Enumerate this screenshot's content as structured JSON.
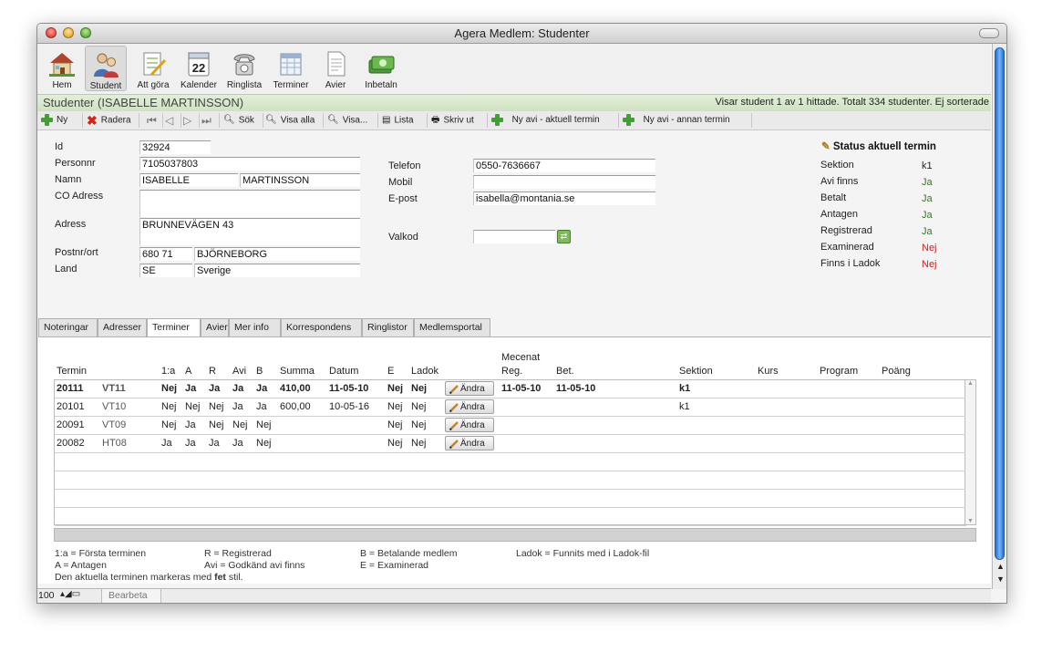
{
  "window": {
    "title": "Agera Medlem: Studenter"
  },
  "toolbar": [
    {
      "label": "Hem",
      "icon": "house-icon"
    },
    {
      "label": "Student",
      "icon": "student-icon"
    },
    {
      "label": "Att göra",
      "icon": "todo-icon"
    },
    {
      "label": "Kalender",
      "icon": "calendar-icon",
      "day": "22"
    },
    {
      "label": "Ringlista",
      "icon": "telephone-icon"
    },
    {
      "label": "Terminer",
      "icon": "term-calendar-icon"
    },
    {
      "label": "Avier",
      "icon": "document-icon"
    },
    {
      "label": "Inbetaln",
      "icon": "money-icon"
    }
  ],
  "header": {
    "title": "Studenter (ISABELLE MARTINSSON)",
    "status": "Visar student 1 av 1 hittade. Totalt 334 studenter. Ej sorterade"
  },
  "actions": {
    "new": "Ny",
    "delete": "Radera",
    "search": "Sök",
    "show_all": "Visa alla",
    "show": "Visa...",
    "list": "Lista",
    "print": "Skriv ut",
    "new_avi_current": "Ny avi - aktuell termin",
    "new_avi_other": "Ny avi - annan termin"
  },
  "form": {
    "labels": {
      "id": "Id",
      "personnr": "Personnr",
      "namn": "Namn",
      "co": "CO Adress",
      "adress": "Adress",
      "postnr": "Postnr/ort",
      "land": "Land",
      "telefon": "Telefon",
      "mobil": "Mobil",
      "epost": "E-post",
      "valkod": "Valkod"
    },
    "values": {
      "id": "32924",
      "personnr": "7105037803",
      "first_name": "ISABELLE",
      "last_name": "MARTINSSON",
      "co": "",
      "adress": "BRUNNEVÄGEN 43",
      "postnr": "680 71",
      "ort": "BJÖRNEBORG",
      "land_code": "SE",
      "land": "Sverige",
      "telefon": "0550-7636667",
      "mobil": "",
      "epost": "isabella@montania.se",
      "valkod": ""
    }
  },
  "status": {
    "title": "Status aktuell termin",
    "items": [
      {
        "label": "Sektion",
        "value": "k1",
        "color": "#222222"
      },
      {
        "label": "Avi finns",
        "value": "Ja",
        "color": "#2f7d1f"
      },
      {
        "label": "Betalt",
        "value": "Ja",
        "color": "#2f7d1f"
      },
      {
        "label": "Antagen",
        "value": "Ja",
        "color": "#2f7d1f"
      },
      {
        "label": "Registrerad",
        "value": "Ja",
        "color": "#2f7d1f"
      },
      {
        "label": "Examinerad",
        "value": "Nej",
        "color": "#cc2020"
      },
      {
        "label": "Finns i Ladok",
        "value": "Nej",
        "color": "#cc2020"
      }
    ]
  },
  "tabs": [
    "Noteringar",
    "Adresser",
    "Terminer",
    "Avier",
    "Mer info",
    "Korrespondens",
    "Ringlistor",
    "Medlemsportal"
  ],
  "active_tab": "Terminer",
  "table": {
    "group_header": "Mecenat",
    "columns": [
      "Termin",
      "1:a",
      "A",
      "R",
      "Avi",
      "B",
      "Summa",
      "Datum",
      "E",
      "Ladok",
      "Reg.",
      "Bet.",
      "Sektion",
      "Kurs",
      "Program",
      "Poäng"
    ],
    "edit_label": "Ändra",
    "rows": [
      {
        "termin": "20111",
        "kod": "VT11",
        "forsta": "Nej",
        "a": "Ja",
        "r": "Ja",
        "avi": "Ja",
        "b": "Ja",
        "summa": "410,00",
        "datum": "11-05-10",
        "e": "Nej",
        "ladok": "Nej",
        "reg": "11-05-10",
        "bet": "11-05-10",
        "sektion": "k1",
        "current": true
      },
      {
        "termin": "20101",
        "kod": "VT10",
        "forsta": "Nej",
        "a": "Nej",
        "r": "Nej",
        "avi": "Ja",
        "b": "Ja",
        "summa": "600,00",
        "datum": "10-05-16",
        "e": "Nej",
        "ladok": "Nej",
        "reg": "",
        "bet": "",
        "sektion": "k1",
        "current": false
      },
      {
        "termin": "20091",
        "kod": "VT09",
        "forsta": "Nej",
        "a": "Ja",
        "r": "Nej",
        "avi": "Nej",
        "b": "Nej",
        "summa": "",
        "datum": "",
        "e": "Nej",
        "ladok": "Nej",
        "reg": "",
        "bet": "",
        "sektion": "",
        "current": false
      },
      {
        "termin": "20082",
        "kod": "HT08",
        "forsta": "Ja",
        "a": "Ja",
        "r": "Ja",
        "avi": "Ja",
        "b": "Nej",
        "summa": "",
        "datum": "",
        "e": "Nej",
        "ladok": "Nej",
        "reg": "",
        "bet": "",
        "sektion": "",
        "current": false
      }
    ]
  },
  "legend": {
    "forsta": "1:a    = Första terminen",
    "antagen": "A       = Antagen",
    "reg": "R      = Registrerad",
    "avi": "Avi    = Godkänd avi finns",
    "betal": "B      = Betalande medlem",
    "exam": "E      = Examinerad",
    "ladok": "Ladok   = Funnits med i Ladok-fil",
    "note_prefix": "Den aktuella terminen markeras med ",
    "note_bold": "fet",
    "note_suffix": " stil."
  },
  "bottom": {
    "zoom": "100",
    "mode": "Bearbeta"
  }
}
